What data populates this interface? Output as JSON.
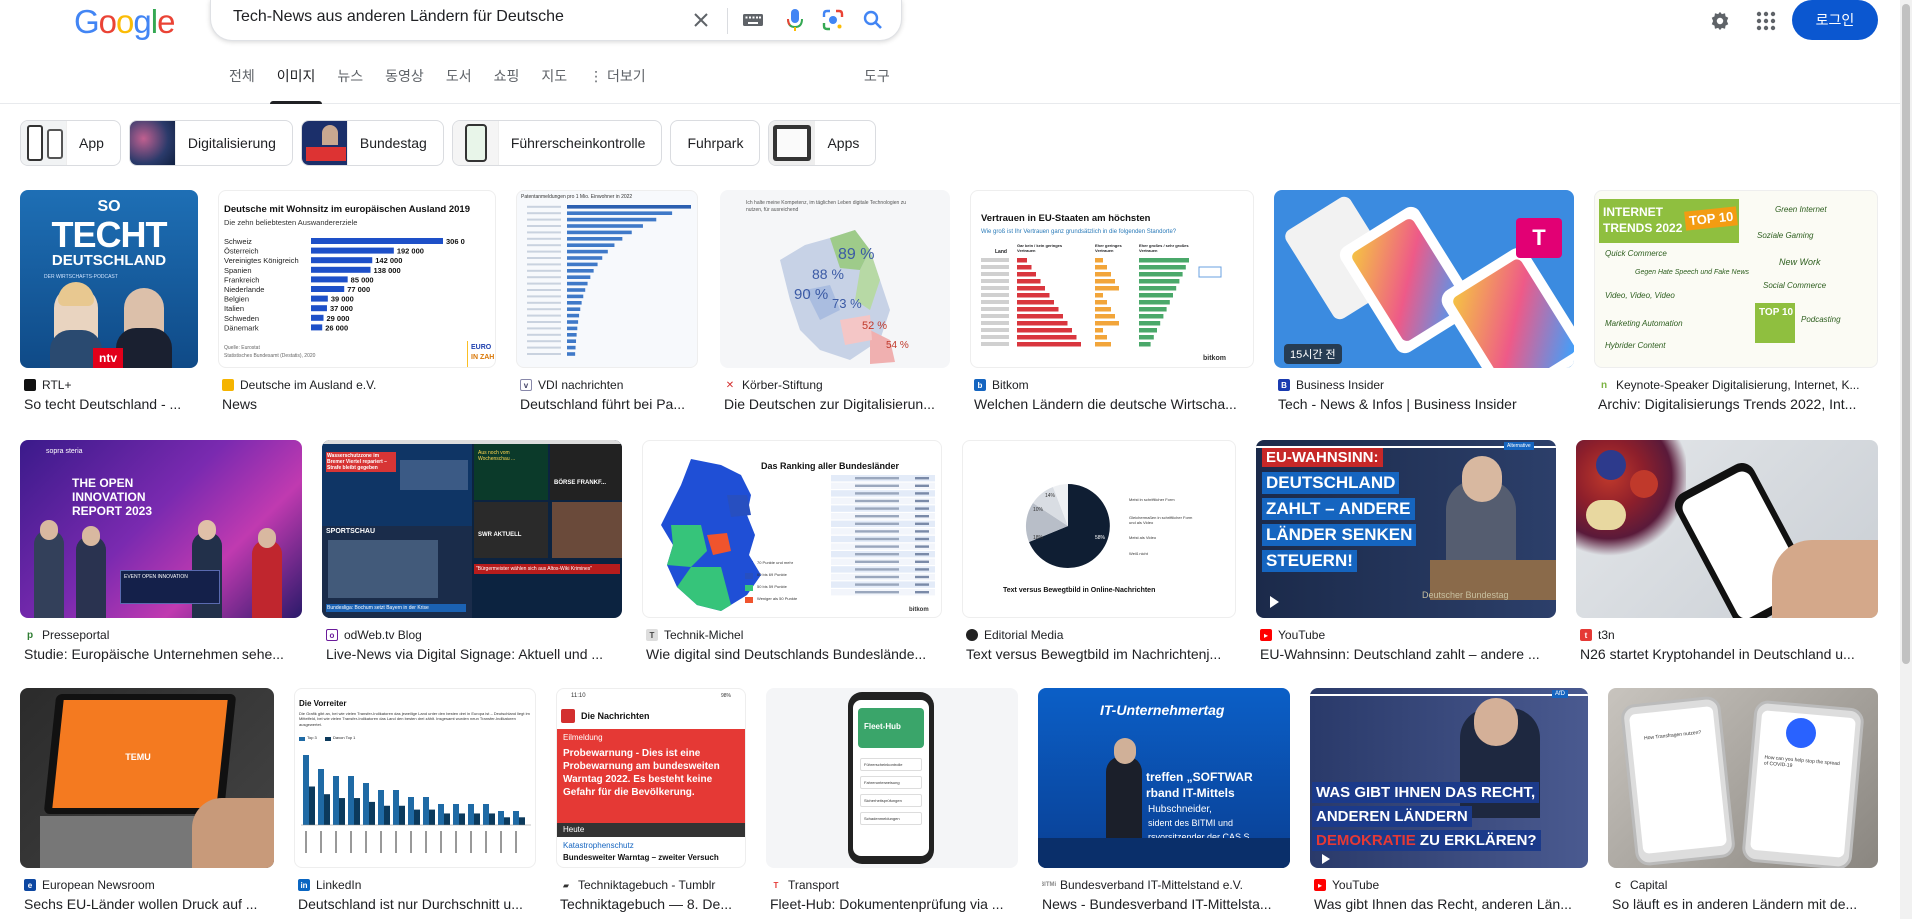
{
  "search": {
    "query": "Tech-News aus anderen Ländern für Deutsche"
  },
  "header": {
    "login": "로그인"
  },
  "tabs": [
    "전체",
    "이미지",
    "뉴스",
    "동영상",
    "도서",
    "쇼핑",
    "지도",
    "⋮ 더보기"
  ],
  "tools": "도구",
  "chips": [
    "App",
    "Digitalisierung",
    "Bundestag",
    "Führerscheinkontrolle",
    "Fuhrpark",
    "Apps"
  ],
  "results": [
    {
      "source": "RTL+",
      "title": "So techt Deutschland - ..."
    },
    {
      "source": "Deutsche im Ausland e.V.",
      "title": "News"
    },
    {
      "source": "VDI nachrichten",
      "title": "Deutschland führt bei Pa..."
    },
    {
      "source": "Körber-Stiftung",
      "title": "Die Deutschen zur Digitalisierun..."
    },
    {
      "source": "Bitkom",
      "title": "Welchen Ländern die deutsche Wirtscha..."
    },
    {
      "source": "Business Insider",
      "title": "Tech - News & Infos | Business Insider",
      "badge": "15시간 전"
    },
    {
      "source": "Keynote-Speaker Digitalisierung, Internet, K...",
      "title": "Archiv: Digitalisierungs Trends 2022, Int..."
    },
    {
      "source": "Presseportal",
      "title": "Studie: Europäische Unternehmen sehe..."
    },
    {
      "source": "odWeb.tv Blog",
      "title": "Live-News via Digital Signage: Aktuell und ..."
    },
    {
      "source": "Technik-Michel",
      "title": "Wie digital sind Deutschlands Bundeslände..."
    },
    {
      "source": "Editorial Media",
      "title": "Text versus Bewegtbild im Nachrichtenj..."
    },
    {
      "source": "YouTube",
      "title": "EU-Wahnsinn: Deutschland zahlt – andere ..."
    },
    {
      "source": "t3n",
      "title": "N26 startet Kryptohandel in Deutschland u..."
    },
    {
      "source": "European Newsroom",
      "title": "Sechs EU-Länder wollen Druck auf ..."
    },
    {
      "source": "LinkedIn",
      "title": "Deutschland ist nur Durchschnitt u..."
    },
    {
      "source": "Techniktagebuch - Tumblr",
      "title": "Techniktagebuch — 8. De..."
    },
    {
      "source": "Transport",
      "title": "Fleet-Hub: Dokumentenprüfung via ..."
    },
    {
      "source": "Bundesverband IT-Mittelstand e.V.",
      "title": "News - Bundesverband IT-Mittelsta..."
    },
    {
      "source": "YouTube",
      "title": "Was gibt Ihnen das Recht, anderen Län..."
    },
    {
      "source": "Capital",
      "title": "So läuft es in anderen Ländern mit de..."
    }
  ],
  "thumbs": {
    "rtl": {
      "l1": "SO",
      "l2": "TECHT",
      "l3": "DEUTSCHLAND",
      "l4": "DER WIRTSCHAFTS-PODCAST",
      "logo": "ntv"
    },
    "ausland": {
      "title": "Deutsche mit Wohnsitz im europäischen Ausland 2019",
      "subtitle": "Die zehn beliebtesten Auswandererziele",
      "rows": [
        {
          "c": "Schweiz",
          "v": 306000,
          "l": "306 0"
        },
        {
          "c": "Österreich",
          "v": 192000,
          "l": "192 000"
        },
        {
          "c": "Vereinigtes Königreich",
          "v": 142000,
          "l": "142 000"
        },
        {
          "c": "Spanien",
          "v": 138000,
          "l": "138 000"
        },
        {
          "c": "Frankreich",
          "v": 85000,
          "l": "85 000"
        },
        {
          "c": "Niederlande",
          "v": 77000,
          "l": "77 000"
        },
        {
          "c": "Belgien",
          "v": 39000,
          "l": "39 000"
        },
        {
          "c": "Italien",
          "v": 37000,
          "l": "37 000"
        },
        {
          "c": "Schweden",
          "v": 29000,
          "l": "29 000"
        },
        {
          "c": "Dänemark",
          "v": 26000,
          "l": "26 000"
        }
      ],
      "src1": "Quelle: Eurostat",
      "src2": "Statistisches Bundesamt (Destatis), 2020",
      "corner1": "EURO",
      "corner2": "IN ZAH"
    },
    "vdi": {
      "title": "Patentanmeldungen pro 1 Mio. Einwohner in 2022"
    },
    "koerber": {
      "head": "Ich halte meine Kompetenz, im täglichen Leben digitale Technologien zu nutzen, für ausreichend",
      "p1": "89 %",
      "p2": "88 %",
      "p3": "90 %",
      "p4": "73 %",
      "p5": "52 %",
      "p6": "54 %"
    },
    "bitkom": {
      "title": "Vertrauen in EU-Staaten am höchsten",
      "subtitle": "Wie groß ist Ihr Vertrauen ganz grundsätzlich in die folgenden Standorte?",
      "logo": "bitkom",
      "col1": "Land",
      "col2": "Gar kein / kein geringes Vertrauen",
      "col3": "Eher geringes Vertrauen",
      "col4": "Eher großes / sehr großes Vertrauen"
    },
    "insider": {
      "logo": "T"
    },
    "trends": {
      "t1": "INTERNET",
      "t2": "TRENDS 2022",
      "top": "TOP 10",
      "a": "Quick Commerce",
      "b": "Soziale Gaming",
      "c": "Video, Video, Video",
      "d": "New Work",
      "e": "Social Commerce",
      "f": "Marketing Automation",
      "g": "Podcasting",
      "h": "Hybrider Content",
      "i": "Green Internet",
      "j": "Gegen Hate Speech und Fake News",
      "k": "TOP 10"
    },
    "presse": {
      "brand": "sopra steria",
      "t1": "THE OPEN",
      "t2": "INNOVATION",
      "t3": "REPORT 2023",
      "foot": "EVENT OPEN INNOVATION"
    },
    "odweb": {
      "a": "Wasserschutzzone im Bremer Viertel repariert – Strafe bleibt gegeben",
      "b": "SPORTSCHAU",
      "c": "Bundesliga: Bochum setzt Bayern in der Krise",
      "d": "Bayern-Trainer ... Stand ...",
      "e": "Aus noch vom Wochenschau ...",
      "f": "BÖRSE FRANKF...",
      "g": "SWR AKTUELL",
      "h": "\"Bürgermeister wählen sich aus Altos-Wiki Krimines\""
    },
    "michel": {
      "title": "Das Ranking aller Bundesländer",
      "logo": "bitkom",
      "l1": "70 Punkte und mehr",
      "l2": "60 bis 69 Punkte",
      "l3": "50 bis 59 Punkte",
      "l4": "Weniger als 50 Punkte"
    },
    "editorial": {
      "title": "Text versus Bewegtbild in Online-Nachrichten",
      "p1": "14%",
      "p2": "10%",
      "p3": "18%",
      "p4": "58%",
      "l1": "Meist in schriftlicher Form",
      "l2": "Gleichermaßen in schriftlicher Form und als Video",
      "l3": "Meist als Video",
      "l4": "Weiß nicht"
    },
    "yt1": {
      "l1": "EU-WAHNSINN:",
      "l2": "DEUTSCHLAND",
      "l3": "ZAHLT – ANDERE",
      "l4": "LÄNDER SENKEN",
      "l5": "STEUERN!",
      "tag": "Alternative",
      "foot": "Deutscher Bundestag"
    },
    "t3n": {},
    "temu": {
      "logo": "TEMU"
    },
    "linkedin": {
      "title": "Die Vorreiter",
      "text": "Die Grafik gibt an, bei wie vielen Transfer-Indikatoren das jeweilige Land unter den besten drei in Europa ist – Deutschland liegt im Mittelfeld, bei wie vielen Transfer-Indikatoren das Land den besten drei zählt. Insgesamt wurden neun Transfer-Indikatoren ausgewertet.",
      "l1": "Top 3",
      "l2": "Davon Top 1",
      "bars": [
        10,
        8,
        7,
        7,
        6,
        5,
        5,
        4,
        4,
        3,
        3,
        3,
        3,
        2,
        2
      ]
    },
    "tumblr": {
      "time": "11:10",
      "bat": "98%",
      "head": "Die Nachrichten",
      "tag": "Eilmeldung",
      "msg": "Probewarnung - Dies ist eine Probewarnung am bundesweiten Warntag 2022. Es besteht keine Gefahr für die Bevölkerung.",
      "heute": "Heute",
      "kat": "Katastrophenschutz",
      "sub": "Bundesweiter Warntag – zweiter Versuch"
    },
    "fleet": {
      "logo": "Fleet-Hub",
      "i1": "Führerscheinkontrolle",
      "i2": "Fahrerunterweisung",
      "i3": "Sicherheitsprüfungen",
      "i4": "Schadenmeldungen"
    },
    "bitmi": {
      "t1": "IT-Unternehmertag",
      "t2": "treffen „SOFTWAR",
      "t3": "rband IT-Mittels",
      "t4": "Hubschneider,",
      "t5": "sident des BITMI und",
      "t6": "rsvorsitzender der CAS S"
    },
    "yt2": {
      "l1": "WAS GIBT IHNEN DAS RECHT,",
      "l2": "ANDEREN LÄNDERN",
      "l3a": "DEMOKRATIE",
      "l3b": " ZU ERKLÄREN?",
      "tag": "AfD"
    },
    "capital": {
      "a": "How Transfragen nutzen?",
      "b": "How can you help stop the spread of COVID-19"
    }
  }
}
